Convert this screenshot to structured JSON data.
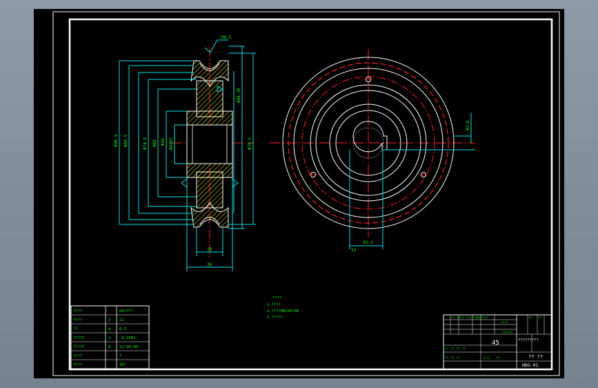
{
  "colors": {
    "viewport_bg": "#000000",
    "border": "#ffffff",
    "dim": "#00e5e5",
    "text": "#00ff00",
    "center": "#ff2020",
    "hatch": "#ffff00",
    "outline": "#ffffff",
    "table": "#ffffff"
  },
  "side_view_labels": {
    "top_callout": "R8.5",
    "dia_outer": "Φ98.9",
    "dia_2": "Φ88.5",
    "dia_3": "Φ74.5",
    "dia_4": "Φ60",
    "dia_5": "Φ56",
    "dia_bore": "Φ40H7",
    "right_1": "Φ84.56",
    "right_2": "Φ70.5",
    "hub_w": "18",
    "total_w": "36"
  },
  "front_view_labels": {
    "right_callout": "Φ3.8",
    "keyway_w": "12",
    "keyway_depth": "43.3"
  },
  "notes": {
    "title": "????",
    "line1": "1.????",
    "line2": "2.????HRC45~50",
    "line3": "3.?????"
  },
  "params_table": {
    "rows": [
      {
        "name": "????",
        "sym": "",
        "val": "ZA????"
      },
      {
        "name": "????",
        "sym": "Z",
        "val": "21"
      },
      {
        "name": "??",
        "sym": "m",
        "val": "6.5"
      },
      {
        "name": "?????",
        "sym": "x",
        "val": "-0.1682"
      },
      {
        "name": "?????",
        "sym": "β",
        "val": "11°18'36\""
      },
      {
        "name": "????",
        "sym": "",
        "val": "7"
      },
      {
        "name": "????",
        "sym": "",
        "val": "20°"
      }
    ]
  },
  "title_block": {
    "material": "45",
    "school": "?????????",
    "part_name": "?? ??",
    "drawing_no": "HDG-01",
    "small_1": "?? ???? ???? ??",
    "small_2": "????????",
    "small_3": "?? ?? ?? ??",
    "small_4": "??????",
    "small_5": "?? ?? ??",
    "small_6": "??",
    "small_7": "1:1",
    "small_8": "????",
    "small_9": "??",
    "small_10": "??"
  }
}
